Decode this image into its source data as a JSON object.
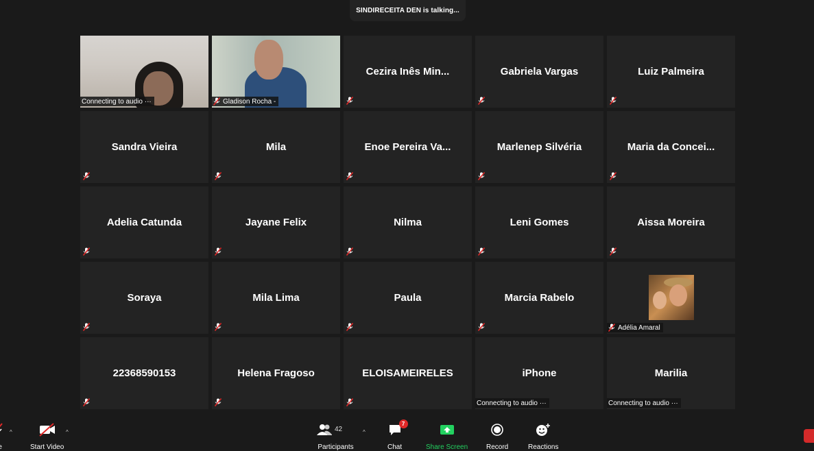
{
  "talking_banner": "SINDIRECEITA DEN is talking...",
  "tiles": [
    {
      "type": "video",
      "variant": "v1",
      "label": "Connecting to audio ···",
      "label_style": "bg",
      "mic": false
    },
    {
      "type": "video",
      "variant": "v2",
      "label": "Gladison Rocha -",
      "label_style": "bg",
      "mic": true
    },
    {
      "type": "name",
      "name": "Cezira Inês Min...",
      "mic": true
    },
    {
      "type": "name",
      "name": "Gabriela Vargas",
      "mic": true
    },
    {
      "type": "name",
      "name": "Luiz Palmeira",
      "mic": true
    },
    {
      "type": "name",
      "name": "Sandra Vieira",
      "mic": true
    },
    {
      "type": "name",
      "name": "Mila",
      "mic": true
    },
    {
      "type": "name",
      "name": "Enoe Pereira Va...",
      "mic": true
    },
    {
      "type": "name",
      "name": "Marlenep Silvéria",
      "mic": true
    },
    {
      "type": "name",
      "name": "Maria da Concei...",
      "mic": true
    },
    {
      "type": "name",
      "name": "Adelia Catunda",
      "mic": true
    },
    {
      "type": "name",
      "name": "Jayane Felix",
      "mic": true
    },
    {
      "type": "name",
      "name": "Nilma",
      "mic": true
    },
    {
      "type": "name",
      "name": "Leni Gomes",
      "mic": true
    },
    {
      "type": "name",
      "name": "Aissa Moreira",
      "mic": true
    },
    {
      "type": "name",
      "name": "Soraya",
      "mic": true
    },
    {
      "type": "name",
      "name": "Mila Lima",
      "mic": true
    },
    {
      "type": "name",
      "name": "Paula",
      "mic": true
    },
    {
      "type": "name",
      "name": "Marcia Rabelo",
      "mic": true
    },
    {
      "type": "avatar",
      "label": "Adélia Amaral",
      "label_style": "bg",
      "mic": true
    },
    {
      "type": "name",
      "name": "22368590153",
      "mic": true
    },
    {
      "type": "name",
      "name": "Helena Fragoso",
      "mic": true
    },
    {
      "type": "name",
      "name": "ELOISAMEIRELES",
      "mic": true
    },
    {
      "type": "name",
      "name": "iPhone",
      "label": "Connecting to audio ···",
      "label_style": "bg",
      "mic": false
    },
    {
      "type": "name",
      "name": "Marilia",
      "label": "Connecting to audio ···",
      "label_style": "bg",
      "mic": false
    }
  ],
  "toolbar": {
    "mute_label": "ute",
    "start_video_label": "Start Video",
    "participants_label": "Participants",
    "participants_count": "42",
    "chat_label": "Chat",
    "chat_badge": "7",
    "share_label": "Share Screen",
    "record_label": "Record",
    "reactions_label": "Reactions"
  },
  "colors": {
    "share_green": "#23d160",
    "mute_red": "#e02828",
    "tile_bg": "#232323"
  }
}
